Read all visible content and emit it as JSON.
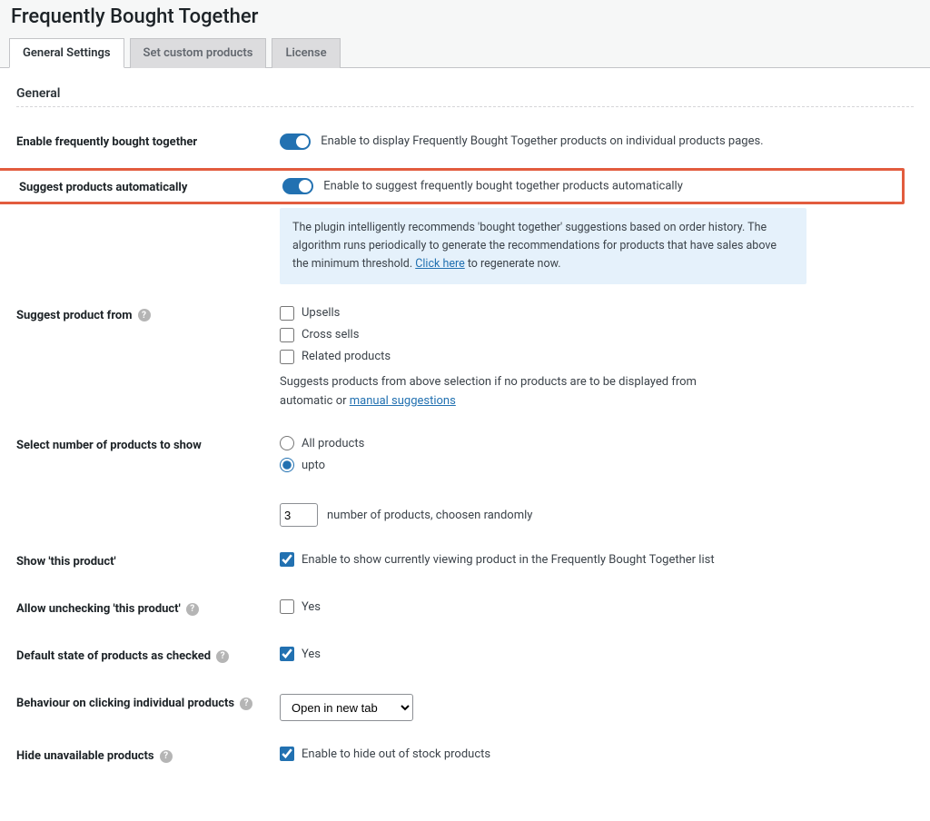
{
  "page_title": "Frequently Bought Together",
  "tabs": {
    "general": "General Settings",
    "custom": "Set custom products",
    "license": "License"
  },
  "section": {
    "general": "General"
  },
  "rows": {
    "enable": {
      "label": "Enable frequently bought together",
      "desc": "Enable to display Frequently Bought Together products on individual products pages."
    },
    "auto_suggest": {
      "label": "Suggest products automatically",
      "desc": "Enable to suggest frequently bought together products automatically"
    },
    "callout_pre": "The plugin intelligently recommends 'bought together' suggestions based on order history. The algorithm runs periodically to generate the recommendations for products that have sales above the minimum threshold. ",
    "callout_link": "Click here",
    "callout_post": " to regenerate now.",
    "suggest_from": {
      "label": "Suggest product from",
      "opt_upsells": "Upsells",
      "opt_cross": "Cross sells",
      "opt_related": "Related products",
      "note_pre": "Suggests products from above selection if no products are to be displayed from automatic or ",
      "note_link": "manual suggestions"
    },
    "num_products": {
      "label": "Select number of products to show",
      "opt_all": "All products",
      "opt_upto": "upto",
      "value": "3",
      "suffix": "number of products, choosen randomly"
    },
    "show_this": {
      "label": "Show 'this product'",
      "desc": "Enable to show currently viewing product in the Frequently Bought Together list"
    },
    "allow_uncheck": {
      "label": "Allow unchecking 'this product'",
      "opt": "Yes"
    },
    "default_checked": {
      "label": "Default state of products as checked",
      "opt": "Yes"
    },
    "behaviour": {
      "label": "Behaviour on clicking individual products",
      "selected": "Open in new tab"
    },
    "hide_unavail": {
      "label": "Hide unavailable products",
      "desc": "Enable to hide out of stock products"
    }
  }
}
